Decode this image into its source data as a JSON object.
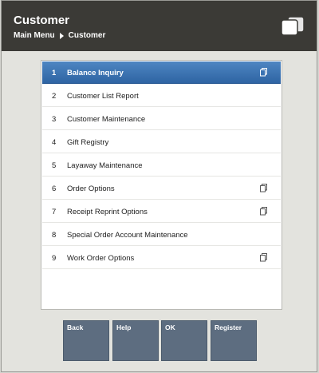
{
  "header": {
    "title": "Customer",
    "breadcrumb": {
      "root": "Main Menu",
      "current": "Customer"
    },
    "icon": "stacked-cards-icon"
  },
  "menu": {
    "items": [
      {
        "num": "1",
        "label": "Balance Inquiry",
        "selected": true,
        "icon": "submenu-icon"
      },
      {
        "num": "2",
        "label": "Customer List Report"
      },
      {
        "num": "3",
        "label": "Customer Maintenance"
      },
      {
        "num": "4",
        "label": "Gift Registry"
      },
      {
        "num": "5",
        "label": "Layaway Maintenance"
      },
      {
        "num": "6",
        "label": "Order Options",
        "icon": "submenu-icon"
      },
      {
        "num": "7",
        "label": "Receipt Reprint Options",
        "icon": "submenu-icon"
      },
      {
        "num": "8",
        "label": "Special Order Account Maintenance"
      },
      {
        "num": "9",
        "label": "Work Order Options",
        "icon": "submenu-icon"
      }
    ]
  },
  "buttons": {
    "back": "Back",
    "help": "Help",
    "ok": "OK",
    "register": "Register"
  },
  "colors": {
    "header_bg": "#3b3a36",
    "selected_row": "#3a73b3",
    "button_bg": "#5d6d80",
    "page_bg": "#e3e3de"
  }
}
